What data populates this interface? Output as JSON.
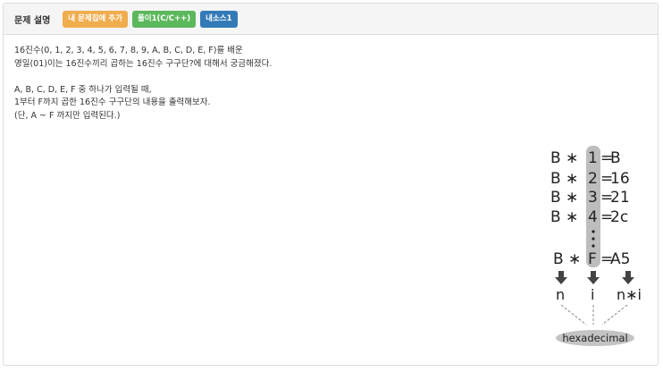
{
  "header": {
    "title": "문제 설명",
    "buttons": [
      {
        "label": "내 문제집에 추가"
      },
      {
        "label": "풀이1(C/C++)"
      },
      {
        "label": "내소스1"
      }
    ]
  },
  "description": {
    "paragraph1": [
      "16진수(0, 1, 2, 3, 4, 5, 6, 7, 8, 9, A, B, C, D, E, F)를 배운",
      "영일(01)이는 16진수끼리 곱하는 16진수 구구단?에 대해서 궁금해졌다."
    ],
    "paragraph2": [
      "A, B, C, D, E, F 중 하나가 입력될 때,",
      "1부터 F까지 곱한 16진수 구구단의 내용을 출력해보자.",
      "(단, A ~ F 까지만 입력된다.)"
    ]
  },
  "figure": {
    "rows": [
      {
        "left": "B",
        "op": "∗",
        "n": "1",
        "eq": "=",
        "result": "B"
      },
      {
        "left": "B",
        "op": "∗",
        "n": "2",
        "eq": "=",
        "result": "16"
      },
      {
        "left": "B",
        "op": "∗",
        "n": "3",
        "eq": "=",
        "result": "21"
      },
      {
        "left": "B",
        "op": "∗",
        "n": "4",
        "eq": "=",
        "result": "2c"
      }
    ],
    "last_row": {
      "left": "B",
      "op": "∗",
      "n": "F",
      "eq": "=",
      "result": "A5"
    },
    "labels": {
      "n": "n",
      "i": "i",
      "ni": "n∗i"
    },
    "caption": "hexadecimal"
  }
}
